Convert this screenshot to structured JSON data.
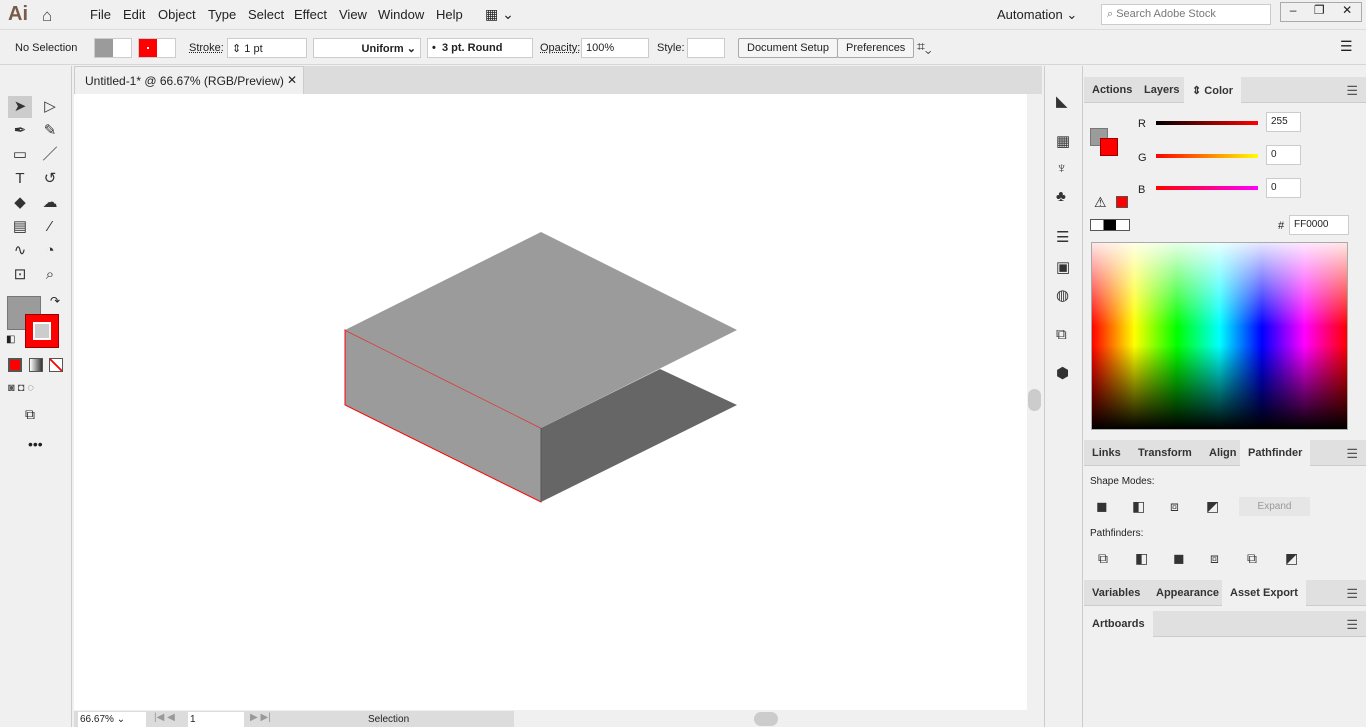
{
  "app": {
    "logo": "Ai",
    "menu": [
      "File",
      "Edit",
      "Object",
      "Type",
      "Select",
      "Effect",
      "View",
      "Window",
      "Help"
    ],
    "workspace": "Automation",
    "search_placeholder": "Search Adobe Stock"
  },
  "control": {
    "selection": "No Selection",
    "stroke_label": "Stroke:",
    "stroke_weight": "1 pt",
    "profile": "Uniform",
    "brush": "3 pt. Round",
    "opacity_label": "Opacity:",
    "opacity": "100%",
    "style_label": "Style:",
    "document_setup": "Document Setup",
    "preferences": "Preferences"
  },
  "document": {
    "tab_title": "Untitled-1* @ 66.67% (RGB/Preview)",
    "fill_color": "#9b9b9b",
    "stroke_color": "#ff0000"
  },
  "status": {
    "zoom": "66.67%",
    "artboard": "1",
    "mode": "Selection"
  },
  "panels": {
    "top_tabs": [
      "Actions",
      "Layers",
      "Color"
    ],
    "color": {
      "r_label": "R",
      "g_label": "G",
      "b_label": "B",
      "r": "255",
      "g": "0",
      "b": "0",
      "hash": "#",
      "hex": "FF0000"
    },
    "mid_tabs": [
      "Links",
      "Transform",
      "Align",
      "Pathfinder"
    ],
    "pathfinder": {
      "shape_modes": "Shape Modes:",
      "expand": "Expand",
      "pathfinders": "Pathfinders:"
    },
    "lower_tabs": [
      "Variables",
      "Appearance",
      "Asset Export"
    ],
    "artboards_tab": "Artboards"
  }
}
